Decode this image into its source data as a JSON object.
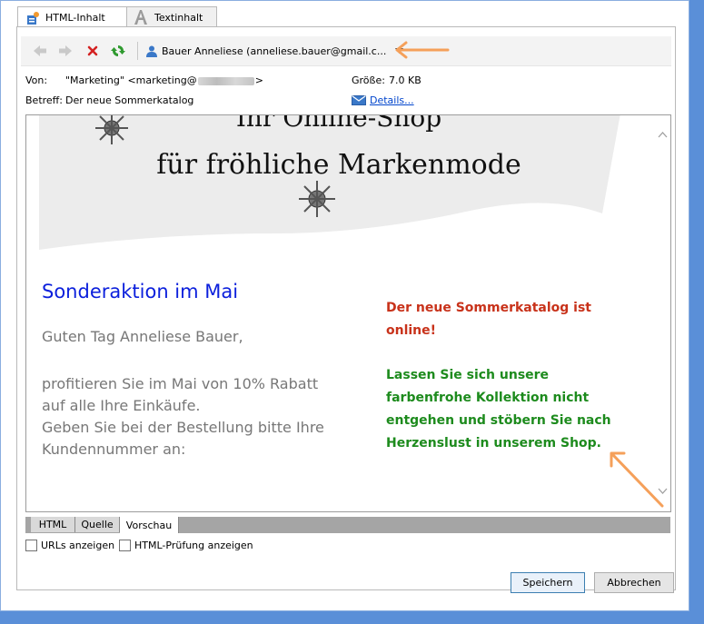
{
  "tabs": [
    {
      "label": "HTML-Inhalt",
      "active": true,
      "icon": "html-content-icon"
    },
    {
      "label": "Textinhalt",
      "active": false,
      "icon": "text-content-icon"
    }
  ],
  "toolbar": {
    "recipient": "Bauer Anneliese (anneliese.bauer@gmail.c..."
  },
  "header": {
    "from_label": "Von:",
    "from_value_start": "\"Marketing\" <marketing@",
    "from_value_end": ">",
    "size_label": "Größe:",
    "size_value": "7.0 KB",
    "subject_label": "Betreff:",
    "subject_value": "Der neue Sommerkatalog",
    "details_link": "Details..."
  },
  "preview": {
    "banner_line1": "Ihr Online-Shop",
    "banner_line2": "für fröhliche Markenmode",
    "heading": "Sonderaktion im Mai",
    "greeting": "Guten Tag  Anneliese Bauer,",
    "body_line1": "profitieren Sie im Mai von 10% Rabatt",
    "body_line2": "auf alle Ihre Einkäufe.",
    "body_line3": "Geben Sie bei der Bestellung bitte Ihre",
    "body_line4": "Kundennummer an:",
    "red_line1": "Der neue Sommerkatalog ist",
    "red_line2": "online!",
    "green_line1": "Lassen Sie sich unsere",
    "green_line2": "farbenfrohe Kollektion nicht",
    "green_line3": "entgehen und stöbern Sie nach",
    "green_line4": "Herzenslust in unserem Shop."
  },
  "view_tabs": [
    {
      "label": "HTML",
      "active": false
    },
    {
      "label": "Quelle",
      "active": false
    },
    {
      "label": "Vorschau",
      "active": true
    }
  ],
  "options": {
    "show_urls": "URLs anzeigen",
    "html_check": "HTML-Prüfung anzeigen"
  },
  "buttons": {
    "save": "Speichern",
    "cancel": "Abbrechen"
  },
  "colors": {
    "heading_blue": "#0b1fdc",
    "offer_red": "#c8321a",
    "offer_green": "#1d8b1d",
    "annotation_arrow": "#f5a05a"
  }
}
